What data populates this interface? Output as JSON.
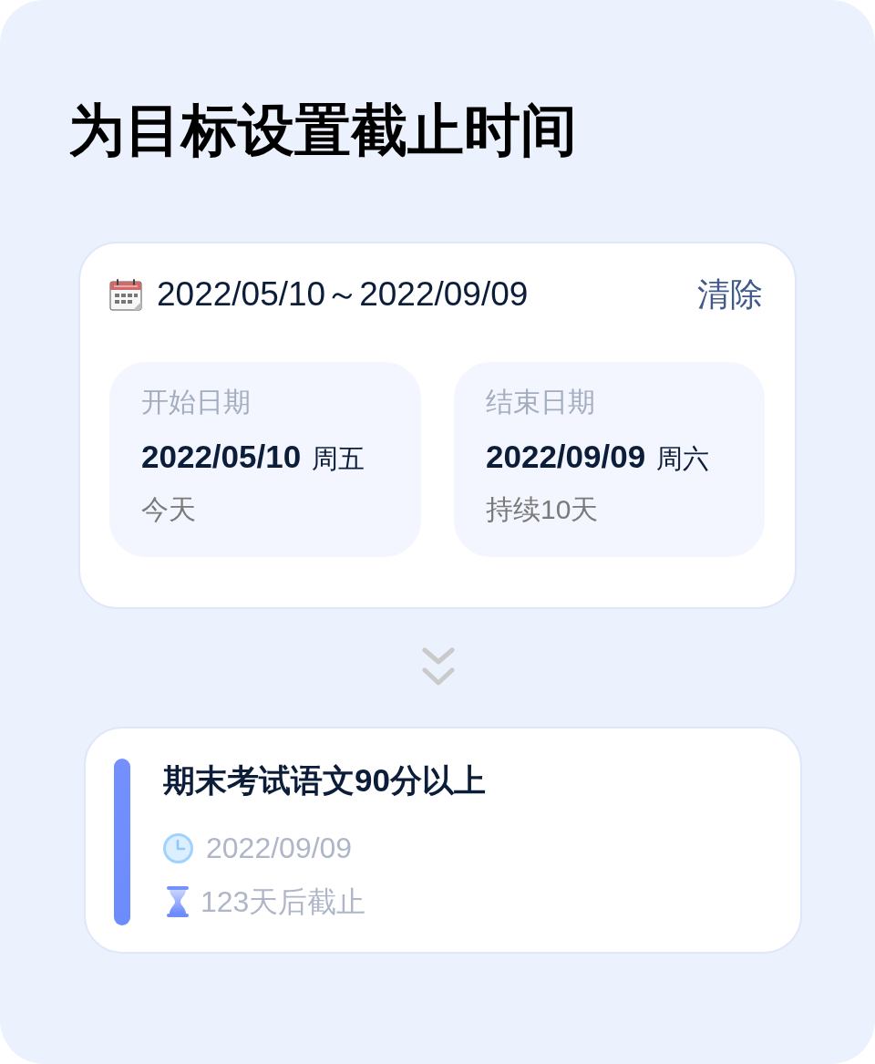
{
  "title": "为目标设置截止时间",
  "range_card": {
    "range": "2022/05/10～2022/09/09",
    "clear_button": "清除",
    "dates": [
      {
        "label": "开始日期",
        "date": "2022/05/10",
        "weekday": "周五",
        "note": "今天"
      },
      {
        "label": "结束日期",
        "date": "2022/09/09",
        "weekday": "周六",
        "note": "持续10天"
      }
    ]
  },
  "goal_card": {
    "title": "期末考试语文90分以上",
    "deadline": "2022/09/09",
    "countdown": "123天后截止"
  }
}
